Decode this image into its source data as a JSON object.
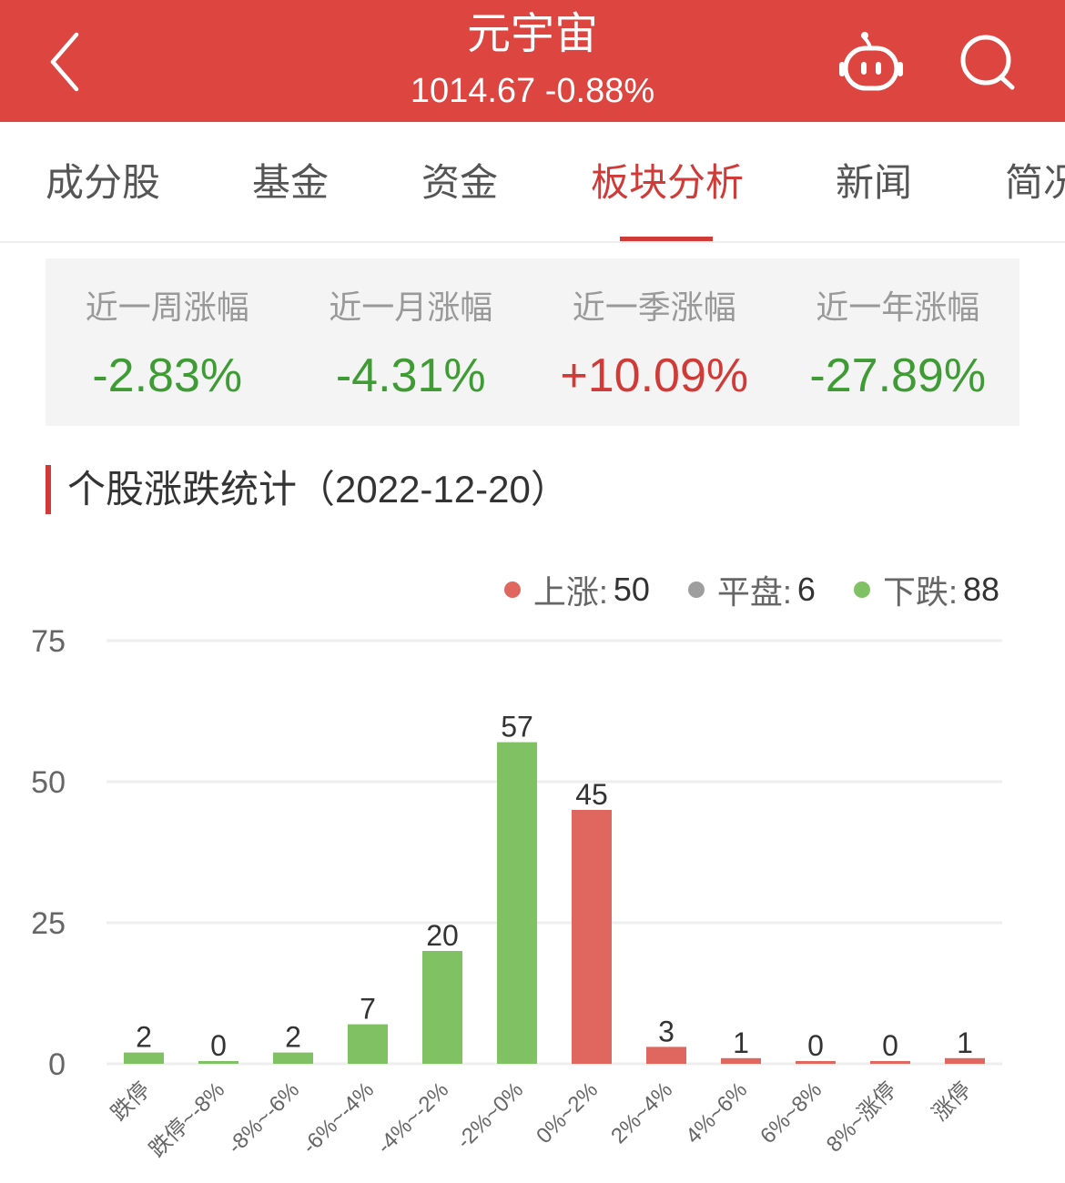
{
  "header": {
    "title": "元宇宙",
    "subtitle": "1014.67 -0.88%",
    "icons": {
      "back": "chevron-left-icon",
      "assistant": "robot-icon",
      "search": "search-icon"
    },
    "bg_color": "#dc4540"
  },
  "tabs": [
    {
      "label": "成分股",
      "active": false
    },
    {
      "label": "基金",
      "active": false
    },
    {
      "label": "资金",
      "active": false
    },
    {
      "label": "板块分析",
      "active": true
    },
    {
      "label": "新闻",
      "active": false
    },
    {
      "label": "简况",
      "active": false
    }
  ],
  "stats": [
    {
      "label": "近一周涨幅",
      "value": "-2.83%",
      "trend": "down"
    },
    {
      "label": "近一月涨幅",
      "value": "-4.31%",
      "trend": "down"
    },
    {
      "label": "近一季涨幅",
      "value": "+10.09%",
      "trend": "up"
    },
    {
      "label": "近一年涨幅",
      "value": "-27.89%",
      "trend": "down"
    }
  ],
  "section": {
    "title": "个股涨跌统计（2022-12-20）"
  },
  "legend": [
    {
      "label": "上涨:",
      "count": "50",
      "color": "#e0675f"
    },
    {
      "label": "平盘:",
      "count": "6",
      "color": "#9e9e9e"
    },
    {
      "label": "下跌:",
      "count": "88",
      "color": "#80c263"
    }
  ],
  "colors": {
    "up": "#e0675f",
    "down": "#80c263",
    "grid": "#eeeeee"
  },
  "chart_data": {
    "type": "bar",
    "title": "个股涨跌统计（2022-12-20）",
    "xlabel": "",
    "ylabel": "",
    "categories": [
      "跌停",
      "跌停~-8%",
      "-8%~-6%",
      "-6%~-4%",
      "-4%~-2%",
      "-2%~0%",
      "0%~2%",
      "2%~4%",
      "4%~6%",
      "6%~8%",
      "8%~涨停",
      "涨停"
    ],
    "values": [
      2,
      0,
      2,
      7,
      20,
      57,
      45,
      3,
      1,
      0,
      0,
      1
    ],
    "bar_colors": [
      "down",
      "down",
      "down",
      "down",
      "down",
      "down",
      "up",
      "up",
      "up",
      "up",
      "up",
      "up"
    ],
    "ylim": [
      0,
      75
    ],
    "yticks": [
      0,
      25,
      50,
      75
    ],
    "grid": true,
    "legend_position": "top-right"
  }
}
